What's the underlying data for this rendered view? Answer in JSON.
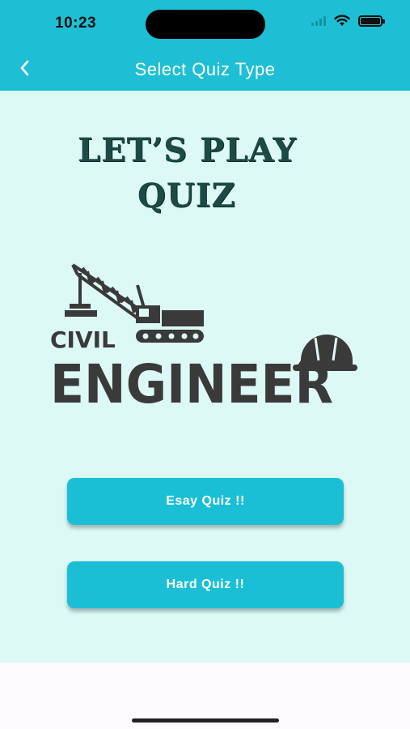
{
  "status_bar": {
    "time": "10:23"
  },
  "nav": {
    "title": "Select Quiz Type"
  },
  "headline": {
    "line1": "LET’S PLAY",
    "line2": "QUIZ"
  },
  "logo": {
    "word1": "CIVIL",
    "word2": "ENGINEER"
  },
  "buttons": {
    "easy": "Esay Quiz !!",
    "hard": "Hard Quiz !!"
  },
  "colors": {
    "accent": "#1ebfd4",
    "background": "#dcf9f6",
    "headline": "#1e4a46"
  },
  "icons": {
    "back": "chevron-left-icon",
    "wifi": "wifi-icon",
    "signal": "cellular-signal-icon",
    "battery": "battery-icon"
  }
}
